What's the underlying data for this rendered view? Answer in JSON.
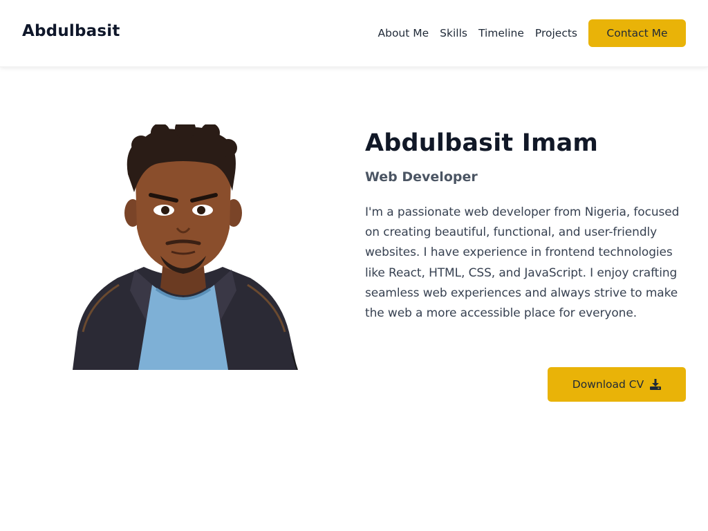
{
  "nav": {
    "brand": "Abdulbasit",
    "links": [
      "About Me",
      "Skills",
      "Timeline",
      "Projects"
    ],
    "contact_label": "Contact Me"
  },
  "hero": {
    "name": "Abdulbasit Imam",
    "role": "Web Developer",
    "bio": "I'm a passionate web developer from Nigeria, focused on creating beautiful, functional, and user-friendly websites. I have experience in frontend technologies like React, HTML, CSS, and JavaScript. I enjoy crafting seamless web experiences and always strive to make the web a more accessible place for everyone.",
    "download_label": "Download CV",
    "download_icon": "download-icon"
  },
  "colors": {
    "accent": "#e9b308",
    "heading": "#111827",
    "muted": "#4b5563"
  }
}
